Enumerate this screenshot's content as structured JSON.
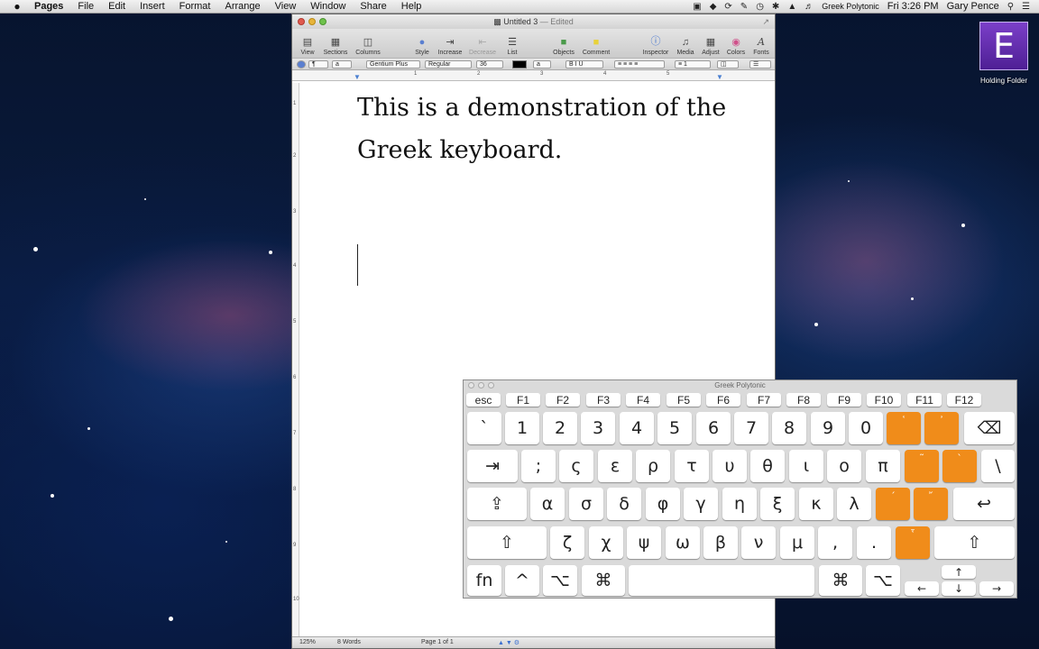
{
  "menubar": {
    "app_name": "Pages",
    "menus": [
      "File",
      "Edit",
      "Insert",
      "Format",
      "Arrange",
      "View",
      "Window",
      "Share",
      "Help"
    ],
    "input_source": "Greek Polytonic",
    "clock": "Fri 3:26 PM",
    "user": "Gary Pence"
  },
  "desktop": {
    "icon_letter": "E",
    "icon_label": "Holding Folder"
  },
  "window": {
    "title": "Untitled 3",
    "edited": "— Edited",
    "toolbar": {
      "view": "View",
      "sections": "Sections",
      "columns": "Columns",
      "style": "Style",
      "increase": "Increase",
      "decrease": "Decrease",
      "list": "List",
      "objects": "Objects",
      "comment": "Comment",
      "inspector": "Inspector",
      "media": "Media",
      "adjust": "Adjust",
      "colors": "Colors",
      "fonts": "Fonts"
    },
    "format_bar": {
      "font_family": "Gentium Plus",
      "font_style": "Regular",
      "font_size": "36"
    },
    "document": {
      "line1": "This is a demonstration of the",
      "line2": "Greek keyboard."
    },
    "status": {
      "zoom": "125%",
      "words": "8 Words",
      "page": "Page 1 of 1"
    }
  },
  "keyboard": {
    "title": "Greek Polytonic",
    "fkeys": [
      "esc",
      "F1",
      "F2",
      "F3",
      "F4",
      "F5",
      "F6",
      "F7",
      "F8",
      "F9",
      "F10",
      "F11",
      "F12"
    ],
    "row1": [
      "`",
      "1",
      "2",
      "3",
      "4",
      "5",
      "6",
      "7",
      "8",
      "9",
      "0",
      "῾",
      "᾿",
      "⌫"
    ],
    "row2": [
      "⇥",
      ";",
      "ς",
      "ε",
      "ρ",
      "τ",
      "υ",
      "θ",
      "ι",
      "ο",
      "π",
      "῀",
      "`",
      "\\"
    ],
    "row3": [
      "⇪",
      "α",
      "σ",
      "δ",
      "φ",
      "γ",
      "η",
      "ξ",
      "κ",
      "λ",
      "´",
      "῎",
      "↩"
    ],
    "row4": [
      "⇧",
      "ζ",
      "χ",
      "ψ",
      "ω",
      "β",
      "ν",
      "μ",
      ",",
      ".",
      "῟",
      "⇧"
    ],
    "row5": [
      "fn",
      "^",
      "⌥",
      "⌘",
      "",
      "⌘",
      "⌥",
      "↑",
      "←",
      "↓",
      "→"
    ],
    "accent_color": "#f08c1a"
  }
}
